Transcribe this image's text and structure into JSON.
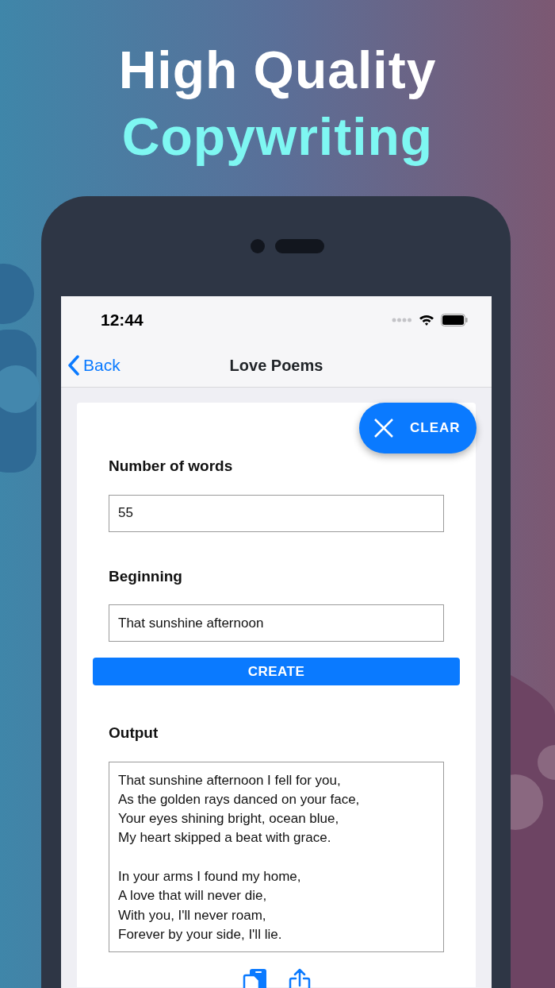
{
  "headline": {
    "line_1": "High Quality",
    "line_2": "Copywriting"
  },
  "status_bar": {
    "time": "12:44"
  },
  "nav_bar": {
    "back": "Back",
    "title": "Love Poems"
  },
  "clear_button": {
    "label": "CLEAR"
  },
  "form": {
    "fields": [
      {
        "label": "Number of words",
        "value": "55"
      },
      {
        "label": "Beginning",
        "value": "That sunshine afternoon"
      }
    ],
    "create_button": "CREATE",
    "output": {
      "label": "Output",
      "value": "That sunshine afternoon I fell for you,\nAs the golden rays danced on your face,\nYour eyes shining bright, ocean blue,\nMy heart skipped a beat with grace.\n\nIn your arms I found my home,\nA love that will never die,\nWith you, I'll never roam,\nForever by your side, I'll lie."
    }
  }
}
